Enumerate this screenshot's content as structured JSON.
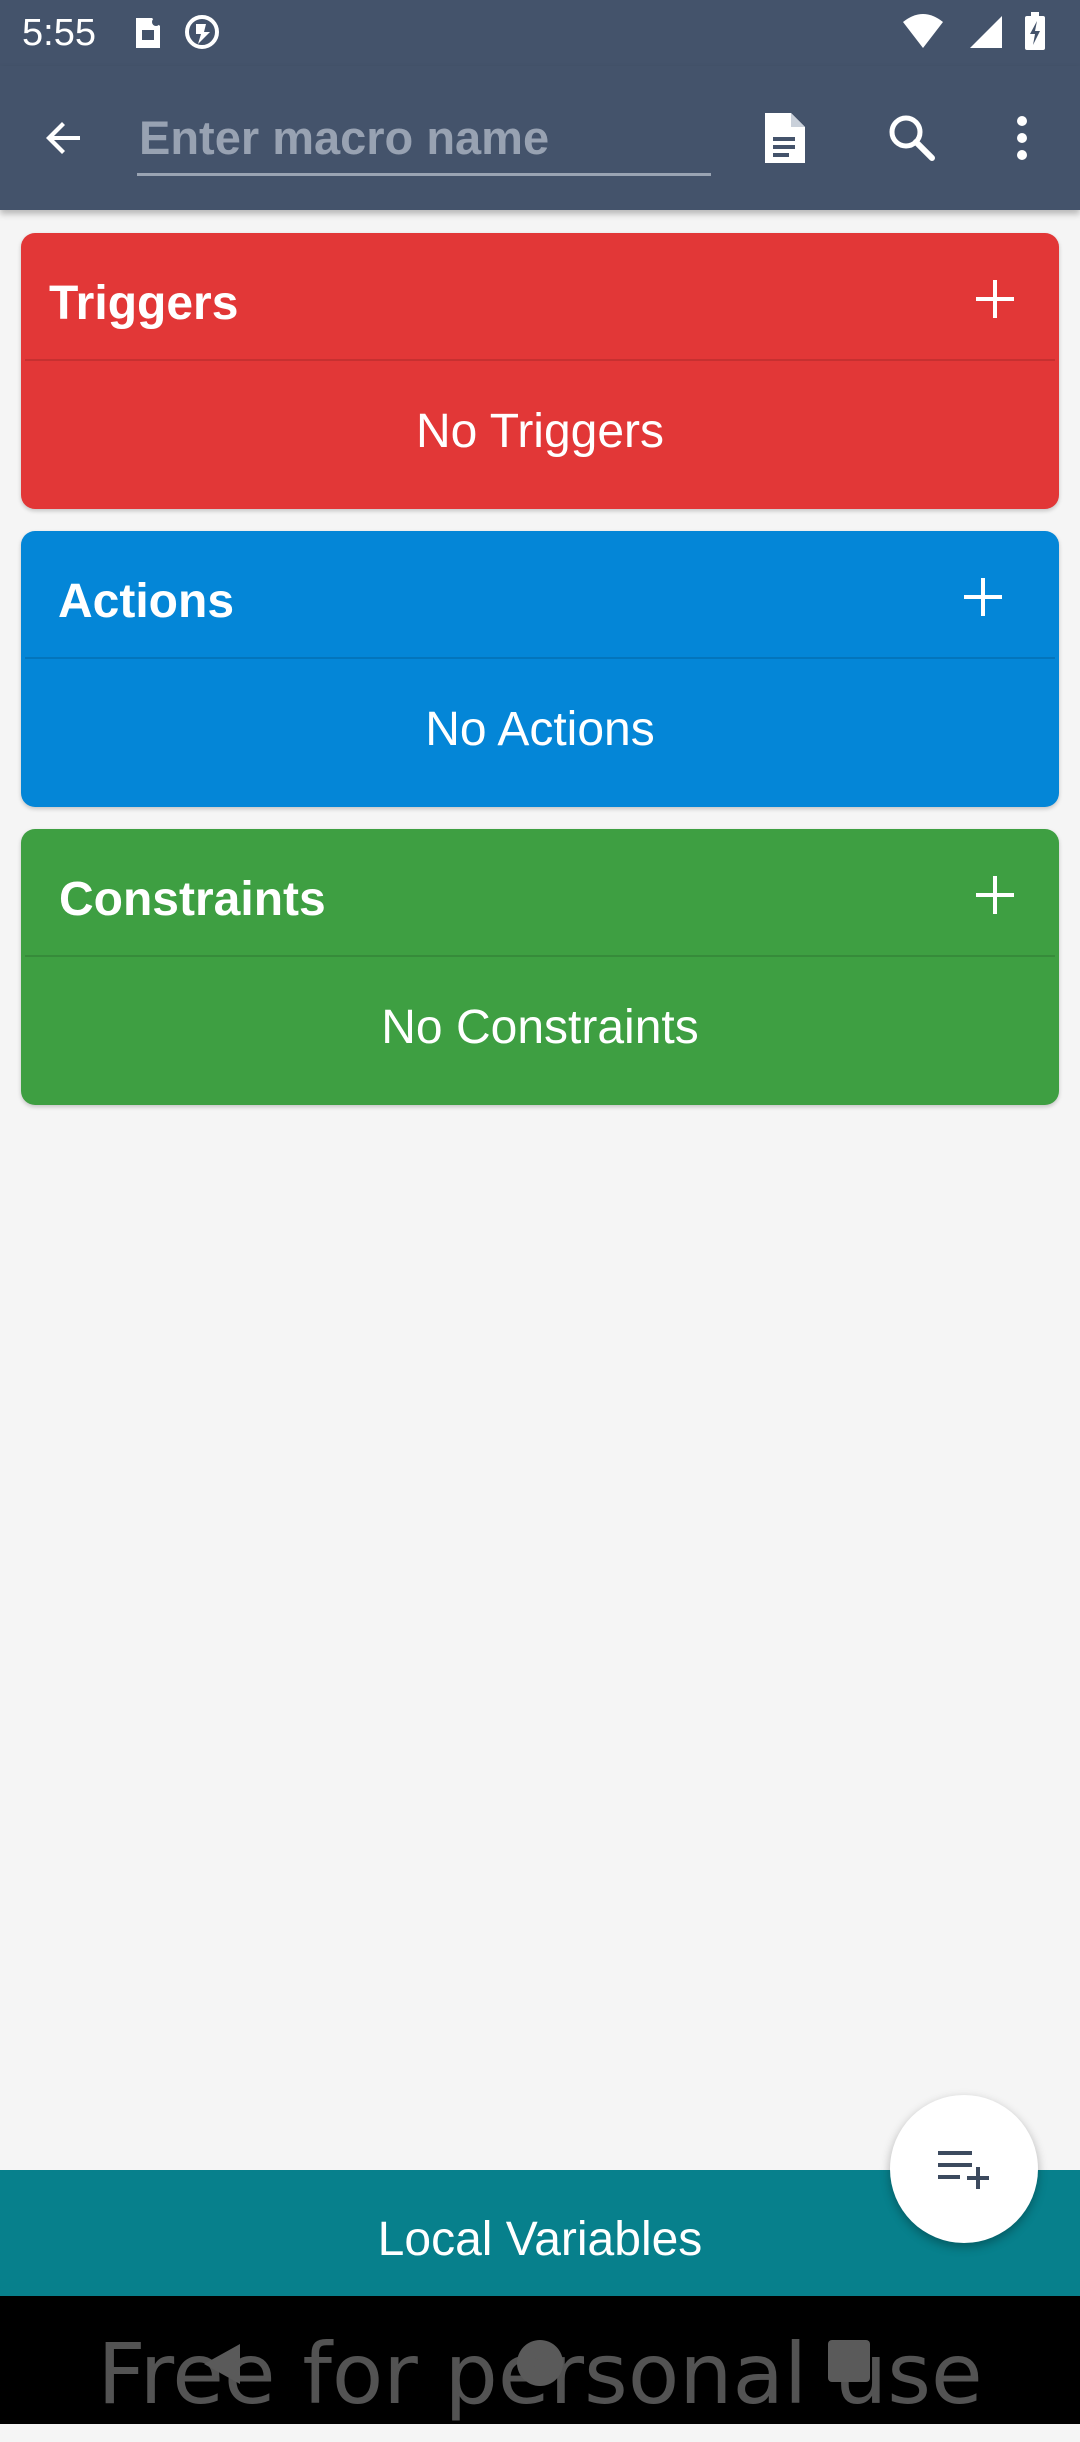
{
  "status_bar": {
    "time": "5:55",
    "left_icons": [
      "sim-card-icon",
      "vpn-icon"
    ],
    "right_icons": [
      "wifi-icon",
      "cell-signal-icon",
      "battery-charging-icon"
    ]
  },
  "toolbar": {
    "name_placeholder": "Enter macro name",
    "name_value": "",
    "icons": [
      "back-arrow-icon",
      "document-icon",
      "search-icon",
      "more-vert-icon"
    ]
  },
  "sections": {
    "triggers": {
      "title": "Triggers",
      "empty": "No Triggers",
      "color": "#e23737"
    },
    "actions": {
      "title": "Actions",
      "empty": "No Actions",
      "color": "#0486d7"
    },
    "constraints": {
      "title": "Constraints",
      "empty": "No Constraints",
      "color": "#3e9f42"
    }
  },
  "bottom": {
    "local_variables_label": "Local Variables",
    "fab_icon": "playlist-add-icon",
    "watermark": "Free for personal use"
  },
  "colors": {
    "toolbar": "#44536b",
    "local_variables_bar": "#07808c",
    "background": "#f5f5f5"
  }
}
